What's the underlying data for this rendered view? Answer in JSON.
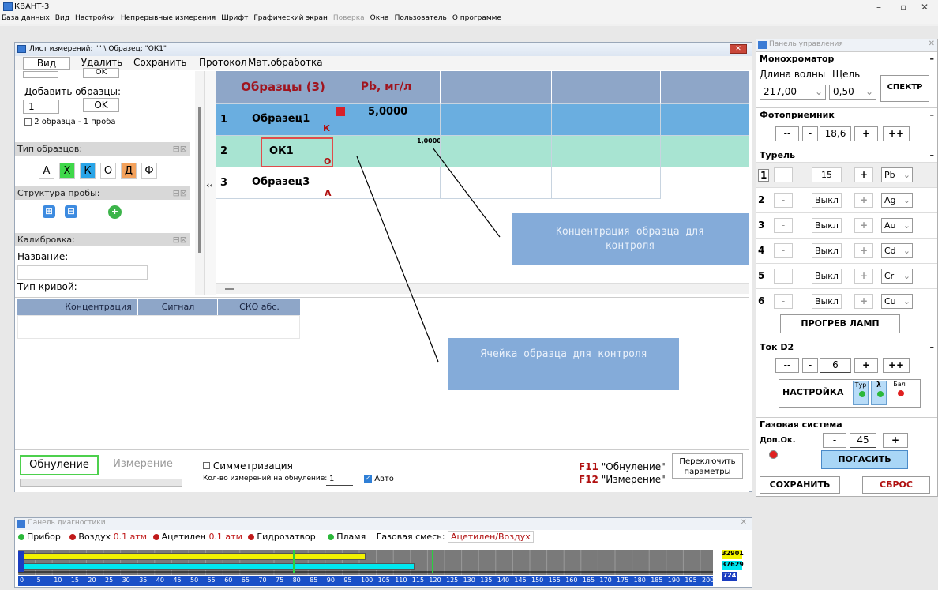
{
  "app": {
    "title": "КВАНТ-3"
  },
  "menu": [
    "База данных",
    "Вид",
    "Настройки",
    "Непрерывные измерения",
    "Шрифт",
    "Графический экран",
    "Поверка",
    "Окна",
    "Пользователь",
    "О программе"
  ],
  "sheet": {
    "title": "Лист измерений: \"\" \\ Образец: \"ОК1\"",
    "toolbar": {
      "view": "Вид",
      "delete": "Удалить",
      "save": "Сохранить",
      "protocol": "Протокол",
      "math": "Мат.обработка"
    },
    "left": {
      "ok_top": "OK",
      "add_label": "Добавить образцы:",
      "add_value": "1",
      "add_ok": "OK",
      "two_samples": "2 образца - 1 проба",
      "types_head": "Тип образцов:",
      "types": [
        "А",
        "Х",
        "К",
        "О",
        "Д",
        "Ф"
      ],
      "struct_head": "Структура пробы:",
      "calib_head": "Калибровка:",
      "name_label": "Название:",
      "curve_label": "Тип кривой:",
      "collapse": "‹‹"
    },
    "table": {
      "header_samples": "Образцы (3)",
      "header_pb": "Pb, мг/л",
      "rows": [
        {
          "num": "1",
          "name": "Образец1",
          "type": "К",
          "value": "5,0000"
        },
        {
          "num": "2",
          "name": "ОК1",
          "type": "О",
          "value": "1,0000"
        },
        {
          "num": "3",
          "name": "Образец3",
          "type": "А",
          "value": ""
        }
      ]
    },
    "calib_table": {
      "c1": "Концентрация",
      "c2": "Сигнал",
      "c3": "СКО абс."
    },
    "bottom": {
      "zero": "Обнуление",
      "measure": "Измерение",
      "sym": "Симметризация",
      "count_label": "Кол-во измерений на обнуление:",
      "count_value": "1",
      "auto": "Авто",
      "f11": "F11",
      "f11_text": "\"Обнуление\"",
      "f12": "F12",
      "f12_text": "\"Измерение\"",
      "switch_params": "Переключить параметры"
    }
  },
  "annotations": {
    "conc": "Концентрация образца для контроля",
    "cell": "Ячейка образца для контроля"
  },
  "control": {
    "title": "Панель управления",
    "mono": "Монохроматор",
    "wave_label": "Длина волны",
    "slit_label": "Щель",
    "wave": "217,00",
    "slit": "0,50",
    "spectr": "СПЕКТР",
    "photo": "Фотоприемник",
    "photo_val": "18,6",
    "turret": "Турель",
    "lamps": [
      {
        "n": "1",
        "val": "15",
        "el": "Pb"
      },
      {
        "n": "2",
        "val": "Выкл",
        "el": "Ag"
      },
      {
        "n": "3",
        "val": "Выкл",
        "el": "Au"
      },
      {
        "n": "4",
        "val": "Выкл",
        "el": "Cd"
      },
      {
        "n": "5",
        "val": "Выкл",
        "el": "Cr"
      },
      {
        "n": "6",
        "val": "Выкл",
        "el": "Cu"
      }
    ],
    "warm": "ПРОГРЕВ ЛАМП",
    "d2": "Ток D2",
    "d2_val": "6",
    "setup": "НАСТРОЙКА",
    "tur": "Тур",
    "lam": "λ",
    "bal": "Бал",
    "gas": "Газовая система",
    "dop": "Доп.Ок.",
    "gas_val": "45",
    "off": "ПОГАСИТЬ",
    "save": "СОХРАНИТЬ",
    "reset": "СБРОС",
    "minus2": "--",
    "minus": "-",
    "plus": "+",
    "plus2": "++"
  },
  "diag": {
    "title": "Панель диагностики",
    "device": "Прибор",
    "air": "Воздух",
    "air_val": "0.1 атм",
    "acet": "Ацетилен",
    "acet_val": "0.1 атм",
    "hydro": "Гидрозатвор",
    "flame": "Пламя",
    "mix_label": "Газовая смесь:",
    "mix": "Ацетилен/Воздух",
    "v1": "32901",
    "v2": "37629",
    "v3": "724",
    "bar1_fraction": 0.5,
    "bar2_fraction": 0.57,
    "ticks": [
      "0",
      "5",
      "10",
      "15",
      "20",
      "25",
      "30",
      "35",
      "40",
      "45",
      "50",
      "55",
      "60",
      "65",
      "70",
      "75",
      "80",
      "85",
      "90",
      "95",
      "100",
      "105",
      "110",
      "115",
      "120",
      "125",
      "130",
      "135",
      "140",
      "145",
      "150",
      "155",
      "160",
      "165",
      "170",
      "175",
      "180",
      "185",
      "190",
      "195",
      "200"
    ]
  }
}
